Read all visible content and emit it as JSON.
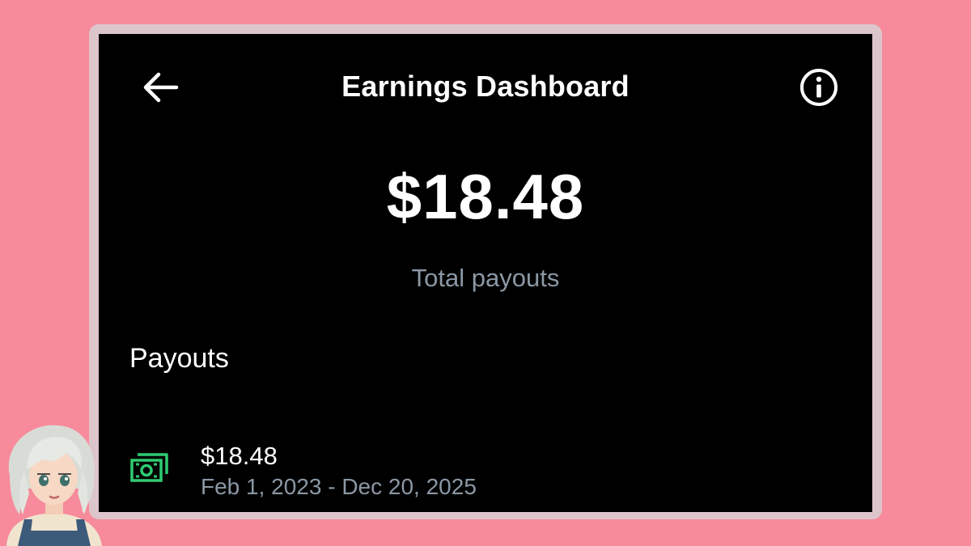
{
  "header": {
    "title": "Earnings Dashboard",
    "back_icon": "arrow-left-icon",
    "info_icon": "info-circle-icon"
  },
  "summary": {
    "amount": "$18.48",
    "label": "Total payouts"
  },
  "payouts": {
    "heading": "Payouts",
    "items": [
      {
        "icon": "cash-icon",
        "amount": "$18.48",
        "date_range": "Feb 1, 2023 - Dec 20, 2025"
      }
    ]
  },
  "colors": {
    "background": "#f78a9b",
    "frame": "#ddc6cb",
    "screen": "#000000",
    "primary_text": "#ffffff",
    "secondary_text": "#8b98a5",
    "cash_icon": "#2ecc71"
  }
}
